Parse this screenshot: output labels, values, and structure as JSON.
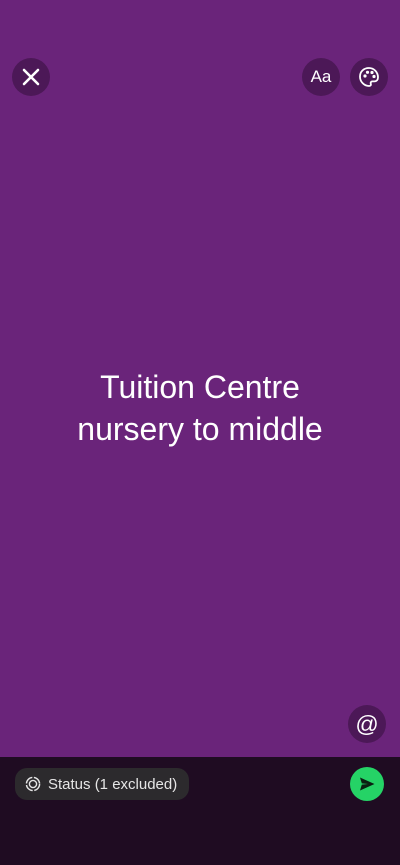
{
  "status": {
    "text_lines": [
      "Tuition Centre",
      "nursery to middle"
    ],
    "background_color": "#6a247a"
  },
  "toolbar": {
    "close_icon": "close-icon",
    "font_label": "Aa",
    "palette_icon": "palette-icon",
    "mention_label": "@"
  },
  "footer": {
    "audience_label": "Status (1 excluded)",
    "audience_icon": "status-ring-icon",
    "send_icon": "send-icon",
    "send_color": "#25d366"
  }
}
